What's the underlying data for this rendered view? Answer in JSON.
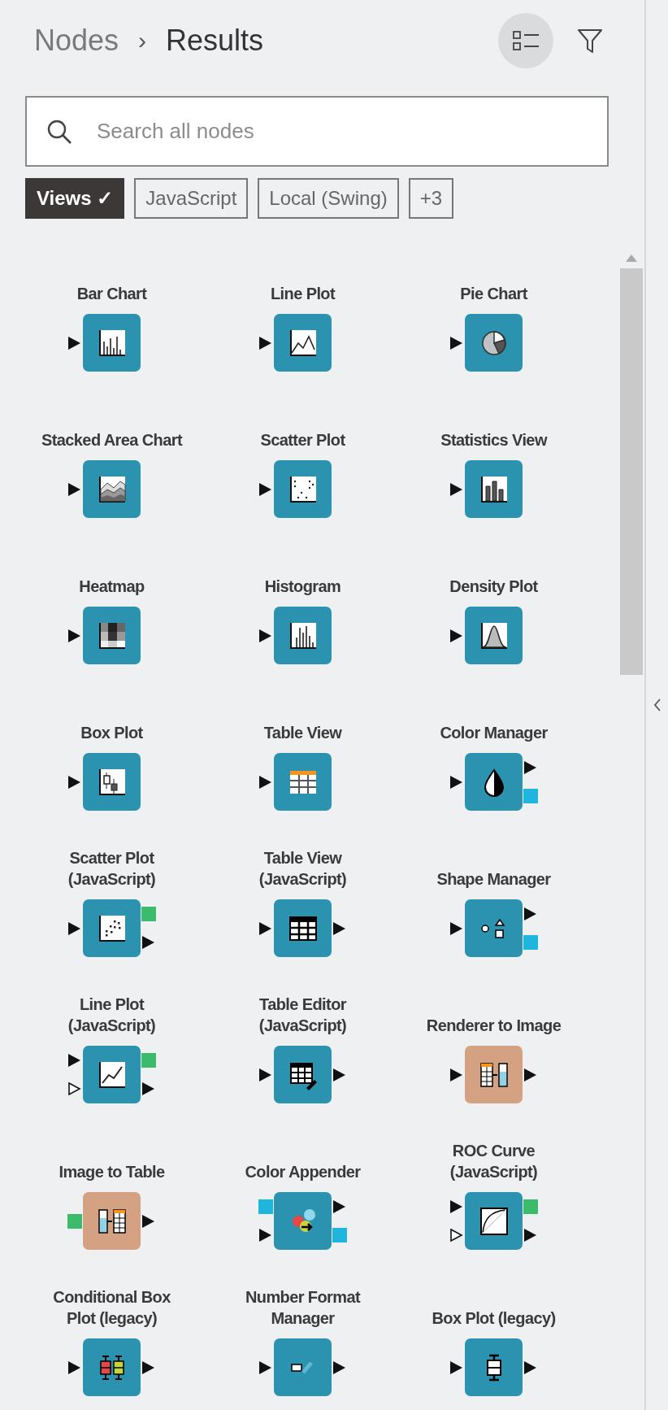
{
  "breadcrumb": [
    {
      "label": "Nodes",
      "current": false
    },
    {
      "label": "›",
      "current": false
    },
    {
      "label": "Results",
      "current": true
    }
  ],
  "list_view": {
    "selected": true
  },
  "search": {
    "placeholder": "Search all nodes"
  },
  "tags": [
    {
      "label": "Views ✓",
      "selected": true
    },
    {
      "label": "JavaScript",
      "selected": false
    },
    {
      "label": "Local (Swing)",
      "selected": false
    },
    {
      "label": "+3",
      "selected": false
    }
  ],
  "nodes": [
    {
      "name": "Bar Chart",
      "color": "#2b93b0",
      "in_ports": [
        {
          "kind": "data"
        }
      ]
    },
    {
      "name": "Line Plot",
      "color": "#2b93b0",
      "in_ports": [
        {
          "kind": "data"
        }
      ]
    },
    {
      "name": "Pie Chart",
      "color": "#2b93b0",
      "in_ports": [
        {
          "kind": "data"
        }
      ]
    },
    {
      "name": "Stacked Area Chart",
      "color": "#2b93b0",
      "in_ports": [
        {
          "kind": "data"
        }
      ]
    },
    {
      "name": "Scatter Plot",
      "color": "#2b93b0",
      "in_ports": [
        {
          "kind": "data"
        }
      ]
    },
    {
      "name": "Statistics View",
      "color": "#2b93b0",
      "in_ports": [
        {
          "kind": "data"
        }
      ]
    },
    {
      "name": "Heatmap",
      "color": "#2b93b0",
      "in_ports": [
        {
          "kind": "data"
        }
      ]
    },
    {
      "name": "Histogram",
      "color": "#2b93b0",
      "in_ports": [
        {
          "kind": "data"
        }
      ]
    },
    {
      "name": "Density Plot",
      "color": "#2b93b0",
      "in_ports": [
        {
          "kind": "data"
        }
      ]
    },
    {
      "name": "Box Plot",
      "color": "#2b93b0",
      "in_ports": [
        {
          "kind": "data"
        }
      ]
    },
    {
      "name": "Table View",
      "color": "#2b93b0",
      "in_ports": [
        {
          "kind": "data"
        }
      ]
    },
    {
      "name": "Color Manager",
      "color": "#2b93b0",
      "in_ports": [
        {
          "kind": "data"
        }
      ],
      "out_ports": [
        {
          "kind": "data"
        },
        {
          "kind": "color"
        }
      ]
    },
    {
      "name": "Scatter Plot (JavaScript)",
      "color": "#2b93b0",
      "in_ports": [
        {
          "kind": "data"
        }
      ],
      "out_ports": [
        {
          "kind": "view"
        },
        {
          "kind": "data"
        }
      ]
    },
    {
      "name": "Table View (JavaScript)",
      "color": "#2b93b0",
      "in_ports": [
        {
          "kind": "data"
        }
      ],
      "out_ports": [
        {
          "kind": "data"
        }
      ]
    },
    {
      "name": "Shape Manager",
      "color": "#2b93b0",
      "in_ports": [
        {
          "kind": "data"
        }
      ],
      "out_ports": [
        {
          "kind": "data"
        },
        {
          "kind": "color"
        }
      ]
    },
    {
      "name": "Line Plot (JavaScript)",
      "color": "#2b93b0",
      "in_ports": [
        {
          "kind": "data"
        },
        {
          "kind": "optional"
        }
      ],
      "out_ports": [
        {
          "kind": "view"
        },
        {
          "kind": "data"
        }
      ]
    },
    {
      "name": "Table Editor (JavaScript)",
      "color": "#2b93b0",
      "in_ports": [
        {
          "kind": "data"
        }
      ],
      "out_ports": [
        {
          "kind": "data"
        }
      ]
    },
    {
      "name": "Renderer to Image",
      "color": "#d4a283",
      "in_ports": [
        {
          "kind": "data"
        }
      ],
      "out_ports": [
        {
          "kind": "data"
        }
      ]
    },
    {
      "name": "Image to Table",
      "color": "#d4a283",
      "in_ports": [
        {
          "kind": "view"
        }
      ],
      "out_ports": [
        {
          "kind": "data"
        }
      ]
    },
    {
      "name": "Color Appender",
      "color": "#2b93b0",
      "in_ports": [
        {
          "kind": "color"
        },
        {
          "kind": "data"
        }
      ],
      "out_ports": [
        {
          "kind": "data"
        },
        {
          "kind": "color"
        }
      ]
    },
    {
      "name": "ROC Curve (JavaScript)",
      "color": "#2b93b0",
      "in_ports": [
        {
          "kind": "data"
        },
        {
          "kind": "optional"
        }
      ],
      "out_ports": [
        {
          "kind": "view"
        },
        {
          "kind": "data"
        }
      ]
    },
    {
      "name": "Conditional Box Plot (legacy)",
      "color": "#2b93b0",
      "in_ports": [
        {
          "kind": "data"
        }
      ],
      "out_ports": [
        {
          "kind": "data"
        }
      ]
    },
    {
      "name": "Number Format Manager",
      "color": "#2b93b0",
      "in_ports": [
        {
          "kind": "data"
        }
      ],
      "out_ports": [
        {
          "kind": "data"
        }
      ]
    },
    {
      "name": "Box Plot (legacy)",
      "color": "#2b93b0",
      "in_ports": [
        {
          "kind": "data"
        }
      ],
      "out_ports": [
        {
          "kind": "data"
        }
      ]
    }
  ]
}
